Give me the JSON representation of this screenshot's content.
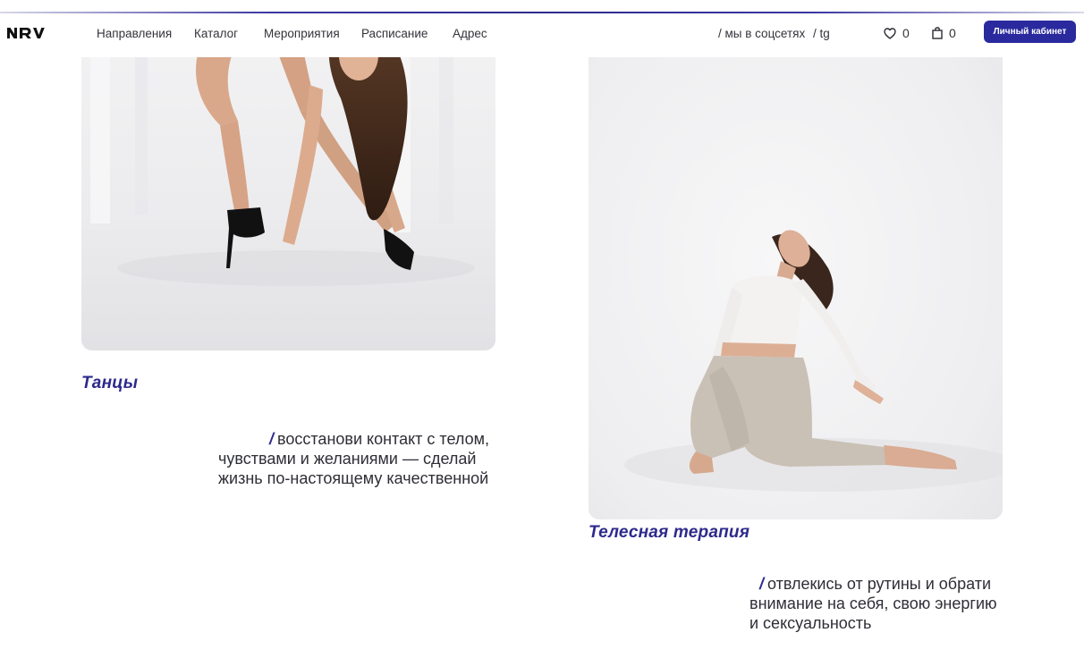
{
  "header": {
    "logo_alt": "NRV",
    "nav": [
      {
        "label": "Направления"
      },
      {
        "label": "Каталог"
      },
      {
        "label": "Мероприятия"
      },
      {
        "label": "Расписание"
      },
      {
        "label": "Адрес"
      }
    ],
    "social_label": "/ мы в соцсетях",
    "social_tg": "/ tg",
    "favorites_count": "0",
    "cart_count": "0",
    "account_button": "Личный кабинет",
    "accent_color": "#2a2a9e"
  },
  "cards": [
    {
      "title": "Танцы",
      "description_lines": [
        "восстанови контакт с телом,",
        "чувствами и желаниями — сделай",
        "жизнь по-настоящему качественной"
      ],
      "slash": "/"
    },
    {
      "title": "Телесная терапия",
      "description_lines": [
        "отвлекись от рутины и обрати",
        "внимание на себя, свою энергию",
        "и сексуальность"
      ],
      "slash": "/"
    }
  ],
  "icons": {
    "favorites": "heart-icon",
    "cart": "shopping-bag-icon"
  },
  "colors": {
    "title": "#2d2a8c",
    "text": "#2e2e36"
  }
}
